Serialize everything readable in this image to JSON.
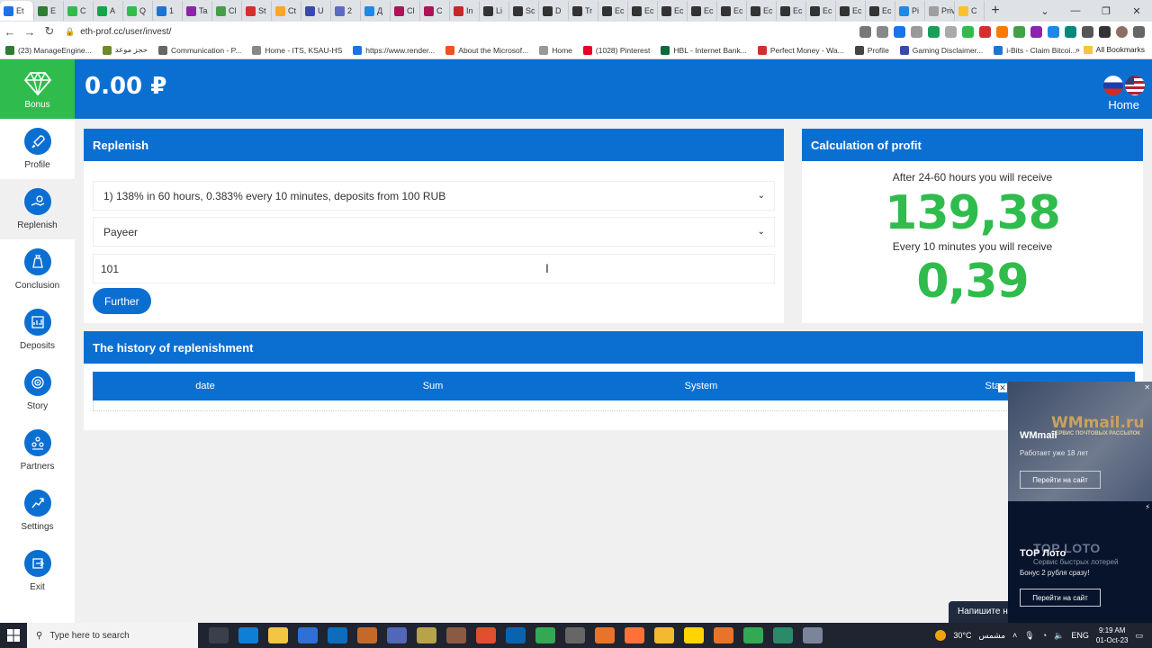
{
  "browser": {
    "url": "eth-prof.cc/user/invest/",
    "tabs": [
      {
        "label": "Et",
        "color": "#1a73e8"
      },
      {
        "label": "E",
        "color": "#2e7d32"
      },
      {
        "label": "C",
        "color": "#2fbc4c"
      },
      {
        "label": "A",
        "color": "#16a34a"
      },
      {
        "label": "Q",
        "color": "#2fbc4c"
      },
      {
        "label": "1",
        "color": "#1976d2"
      },
      {
        "label": "Ta",
        "color": "#8e24aa"
      },
      {
        "label": "Cl",
        "color": "#43a047"
      },
      {
        "label": "St",
        "color": "#d32f2f"
      },
      {
        "label": "Ct",
        "color": "#f9a825"
      },
      {
        "label": "U",
        "color": "#3949ab"
      },
      {
        "label": "2",
        "color": "#5c6bc0"
      },
      {
        "label": "Д",
        "color": "#1e88e5"
      },
      {
        "label": "Cl",
        "color": "#ad1457"
      },
      {
        "label": "C",
        "color": "#ad1457"
      },
      {
        "label": "In",
        "color": "#c62828"
      },
      {
        "label": "Li",
        "color": "#333333"
      },
      {
        "label": "Sc",
        "color": "#333333"
      },
      {
        "label": "D",
        "color": "#333333"
      },
      {
        "label": "Tr",
        "color": "#333333"
      },
      {
        "label": "Ec",
        "color": "#333333"
      },
      {
        "label": "Ec",
        "color": "#333333"
      },
      {
        "label": "Ec",
        "color": "#333333"
      },
      {
        "label": "Ec",
        "color": "#333333"
      },
      {
        "label": "Ec",
        "color": "#333333"
      },
      {
        "label": "Ec",
        "color": "#333333"
      },
      {
        "label": "Ec",
        "color": "#333333"
      },
      {
        "label": "Ec",
        "color": "#333333"
      },
      {
        "label": "Ec",
        "color": "#333333"
      },
      {
        "label": "Ec",
        "color": "#333333"
      },
      {
        "label": "Pi",
        "color": "#1e88e5"
      },
      {
        "label": "Privac",
        "color": "#9e9e9e"
      },
      {
        "label": "C",
        "color": "#fbc02d"
      }
    ],
    "bookmarks": [
      "(23) ManageEngine...",
      "حجز موعد",
      "Communication - P...",
      "Home - ITS, KSAU-HS",
      "https://www.render...",
      "About the Microsof...",
      "Home",
      "(1028) Pinterest",
      "HBL - Internet Bank...",
      "Perfect Money - Wa...",
      "Profile",
      "Gaming Disclaimer...",
      "i-Bits - Claim Bitcoi..."
    ],
    "all_bookmarks": "All Bookmarks"
  },
  "header": {
    "bonus_label": "Bonus",
    "balance": "0.00 ₽",
    "home_label": "Home"
  },
  "sidebar": {
    "items": [
      {
        "label": "Profile",
        "icon": "rocket-icon"
      },
      {
        "label": "Replenish",
        "icon": "hand-coin-icon"
      },
      {
        "label": "Conclusion",
        "icon": "money-bag-icon"
      },
      {
        "label": "Deposits",
        "icon": "chart-icon"
      },
      {
        "label": "Story",
        "icon": "target-icon"
      },
      {
        "label": "Partners",
        "icon": "people-icon"
      },
      {
        "label": "Settings",
        "icon": "growth-icon"
      },
      {
        "label": "Exit",
        "icon": "exit-icon"
      }
    ]
  },
  "replenish": {
    "title": "Replenish",
    "plan_selected": "1) 138% in 60 hours, 0.383% every 10 minutes, deposits from 100 RUB",
    "payment_selected": "Payeer",
    "amount_value": "101",
    "further_label": "Further"
  },
  "profit": {
    "title": "Calculation of profit",
    "line1": "After 24-60 hours you will receive",
    "total": "139,38",
    "line2": "Every 10 minutes you will receive",
    "per10": "0,39"
  },
  "history": {
    "title": "The history of replenishment",
    "columns": [
      "date",
      "Sum",
      "System",
      "Sta"
    ]
  },
  "ad": {
    "top_logo": "WMmail.ru",
    "top_logo_sub": "СЕРВИС ПОЧТОВЫХ РАССЫЛОК",
    "top_title": "WMmail",
    "top_sub": "Работает уже 18 лет",
    "top_button": "Перейти на сайт",
    "bot_logo": "TOP LOTO",
    "bot_logo_sub": "Сервис быстрых лотерей",
    "bot_title": "TOP Лото",
    "bot_sub": "Бонус 2 рубля сразу!",
    "bot_button": "Перейти на сайт",
    "chat_label": "Напишите н"
  },
  "taskbar": {
    "search_placeholder": "Type here to search",
    "weather": "30°C",
    "weather_label": "مشمس",
    "lang": "ENG",
    "time": "9:19 AM",
    "date": "01-Oct-23"
  }
}
